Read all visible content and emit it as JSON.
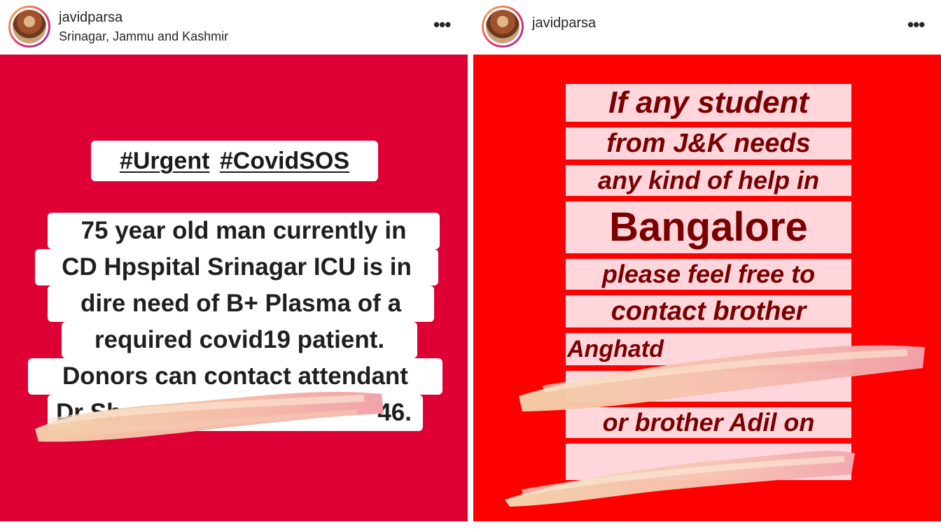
{
  "left_post": {
    "username": "javidparsa",
    "location": "Srinagar, Jammu and Kashmir",
    "more_icon": "more-horizontal-icon",
    "background_color": "#de0034",
    "hashtags": [
      "#Urgent",
      "#CovidSOS"
    ],
    "message_lines": [
      "75 year old man currently in",
      "CD Hpspital Srinagar ICU is in",
      "dire need of B+ Plasma of a",
      "required covid19 patient.",
      "Donors can contact attendant",
      "Dr Sh",
      "46."
    ]
  },
  "right_post": {
    "username": "javidparsa",
    "more_icon": "more-horizontal-icon",
    "background_color": "#ff0000",
    "lines": [
      "If any student",
      "from J&K needs",
      "any kind of help in",
      "Bangalore",
      "please feel free to",
      "contact brother",
      "Anghatd",
      "or brother Adil on"
    ]
  }
}
